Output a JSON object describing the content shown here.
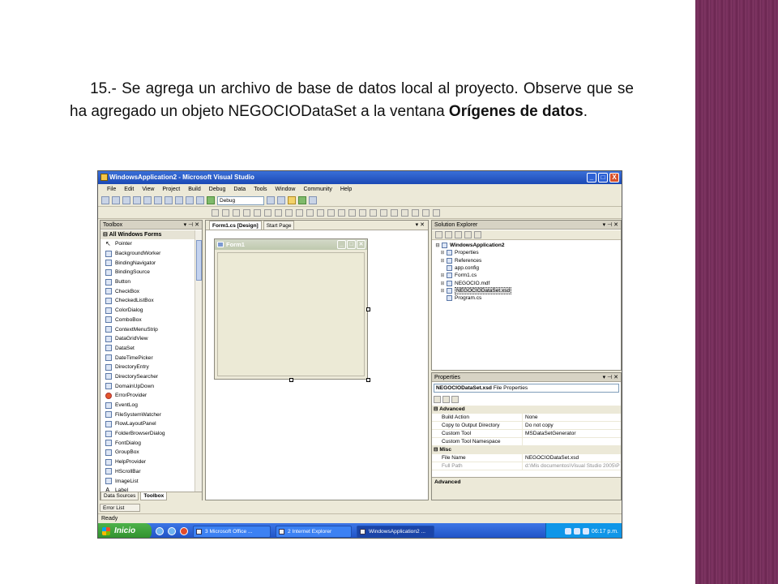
{
  "caption": {
    "number": "15.-",
    "text_before": " Se agrega un archivo de base de datos local al proyecto. Observe que se ha agregado un objeto NEGOCIODataSet a la ventana ",
    "bold": "Orígenes de datos",
    "text_after": "."
  },
  "window": {
    "title": "WindowsApplication2 - Microsoft Visual Studio",
    "buttons": [
      "_",
      "□",
      "X"
    ]
  },
  "menu": [
    "File",
    "Edit",
    "View",
    "Project",
    "Build",
    "Debug",
    "Data",
    "Tools",
    "Window",
    "Community",
    "Help"
  ],
  "toolbar": {
    "config": "Debug"
  },
  "toolbox": {
    "title": "Toolbox",
    "group": "All Windows Forms",
    "items": [
      "Pointer",
      "BackgroundWorker",
      "BindingNavigator",
      "BindingSource",
      "Button",
      "CheckBox",
      "CheckedListBox",
      "ColorDialog",
      "ComboBox",
      "ContextMenuStrip",
      "DataGridView",
      "DataSet",
      "DateTimePicker",
      "DirectoryEntry",
      "DirectorySearcher",
      "DomainUpDown",
      "ErrorProvider",
      "EventLog",
      "FileSystemWatcher",
      "FlowLayoutPanel",
      "FolderBrowserDialog",
      "FontDialog",
      "GroupBox",
      "HelpProvider",
      "HScrollBar",
      "ImageList",
      "Label"
    ],
    "tabs": [
      "Data Sources",
      "Toolbox"
    ]
  },
  "designer": {
    "tabs": [
      "Form1.cs [Design]",
      "Start Page"
    ],
    "form_title": "Form1"
  },
  "solution_explorer": {
    "title": "Solution Explorer",
    "root": "WindowsApplication2",
    "items": [
      "Properties",
      "References",
      "app.config",
      "Form1.cs",
      "NEGOCIO.mdf",
      "NEGOCIODataSet.xsd",
      "Program.cs"
    ],
    "selected": "NEGOCIODataSet.xsd"
  },
  "properties": {
    "title": "Properties",
    "object_name": "NEGOCIODataSet.xsd",
    "object_type": " File Properties",
    "categories": [
      {
        "name": "Advanced",
        "rows": [
          {
            "name": "Build Action",
            "value": "None"
          },
          {
            "name": "Copy to Output Directory",
            "value": "Do not copy"
          },
          {
            "name": "Custom Tool",
            "value": "MSDataSetGenerator"
          },
          {
            "name": "Custom Tool Namespace",
            "value": ""
          }
        ]
      },
      {
        "name": "Misc",
        "rows": [
          {
            "name": "File Name",
            "value": "NEGOCIODataSet.xsd"
          },
          {
            "name": "Full Path",
            "value": "d:\\Mis documentos\\Visual Studio 2005\\P"
          }
        ]
      }
    ],
    "description": "Advanced"
  },
  "error_list": "Error List",
  "status": "Ready",
  "taskbar": {
    "start": "Inicio",
    "tasks": [
      "3 Microsoft Office ...",
      "2 Internet Explorer",
      "WindowsApplication2 ..."
    ],
    "clock": "06:17 p.m."
  },
  "colors": {
    "accent": "#1b49b5",
    "stripe": "#7e3462"
  }
}
